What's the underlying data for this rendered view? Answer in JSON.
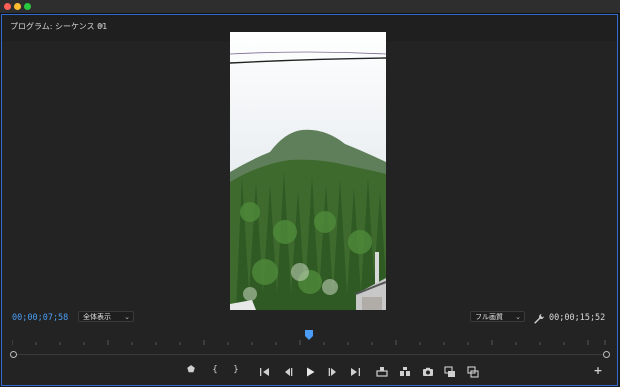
{
  "window": {
    "traffic_lights": [
      "close",
      "minimize",
      "zoom"
    ]
  },
  "panel": {
    "title": "プログラム: シーケンス 01",
    "menu_glyph": "≡"
  },
  "monitor": {
    "current_timecode": "00;00;07;58",
    "duration_timecode": "00;00;15;52",
    "zoom_selected": "全体表示",
    "quality_selected": "フル画質",
    "playhead_position_ratio": 0.5
  },
  "controls": {
    "marker_glyph": "⬟",
    "in_glyph": "{",
    "out_glyph": "}",
    "add_glyph": "+",
    "items": [
      "add-marker-icon",
      "mark-in-icon",
      "mark-out-icon",
      "go-to-in-icon",
      "step-back-icon",
      "play-icon",
      "step-forward-icon",
      "go-to-out-icon",
      "lift-icon",
      "extract-icon",
      "export-frame-icon",
      "comparison-view-icon",
      "toggle-proxies-icon",
      "button-editor-icon"
    ]
  },
  "colors": {
    "accent": "#4a9cf5",
    "panel_border": "#2f6bd0"
  }
}
